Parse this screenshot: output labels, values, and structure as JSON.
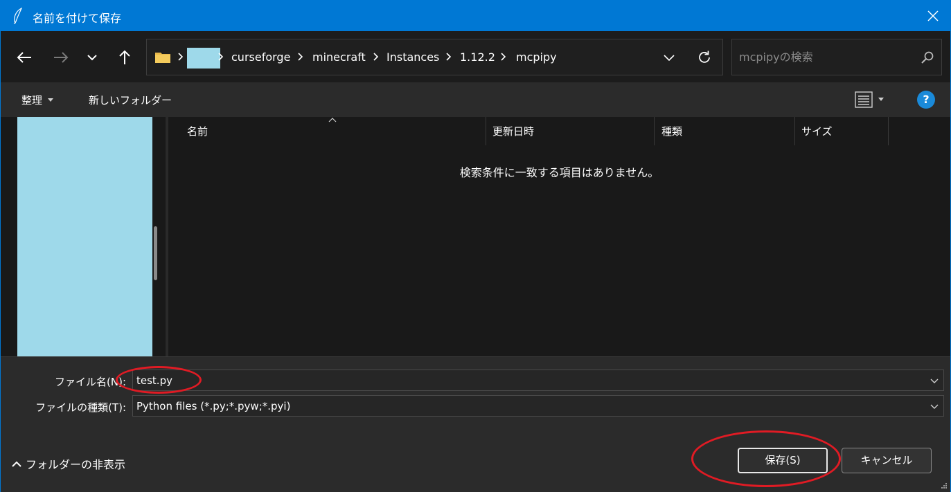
{
  "window": {
    "title": "名前を付けて保存",
    "accent": "#0078d4"
  },
  "nav": {
    "breadcrumbs": [
      "curseforge",
      "minecraft",
      "Instances",
      "1.12.2",
      "mcpipy"
    ]
  },
  "search": {
    "placeholder": "mcpipyの検索"
  },
  "command_bar": {
    "organize_label": "整理",
    "new_folder_label": "新しいフォルダー",
    "help_label": "?"
  },
  "columns": [
    "名前",
    "更新日時",
    "種類",
    "サイズ"
  ],
  "list": {
    "empty_message": "検索条件に一致する項目はありません。"
  },
  "form": {
    "filename_label": "ファイル名(N):",
    "filename_value": "test.py",
    "filetype_label": "ファイルの種類(T):",
    "filetype_value": "Python files (*.py;*.pyw;*.pyi)"
  },
  "footer": {
    "hide_folders_label": "フォルダーの非表示",
    "save_label": "保存(S)",
    "cancel_label": "キャンセル"
  },
  "annotation_color": "#e01b24",
  "redaction_color": "#9ed9ea"
}
